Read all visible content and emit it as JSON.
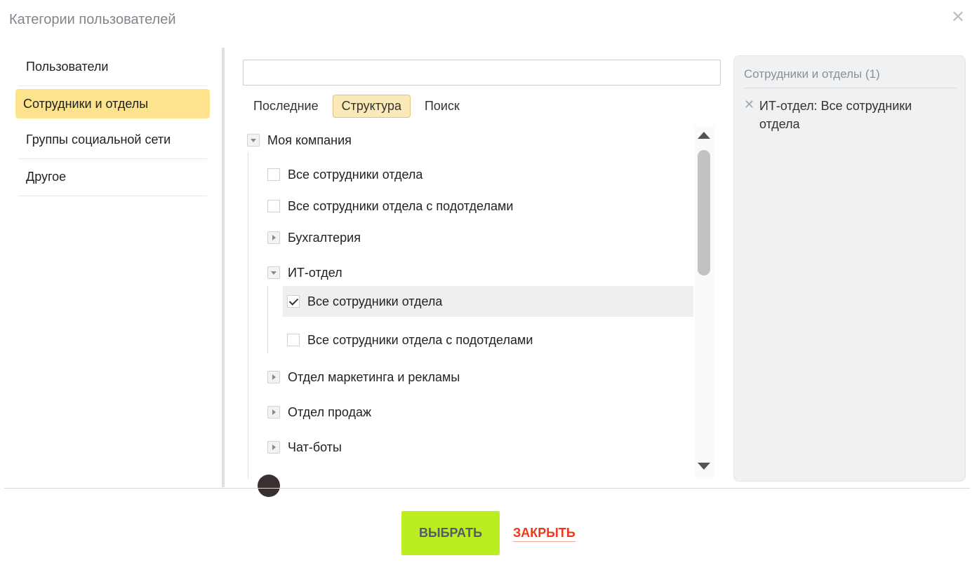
{
  "dialog": {
    "title": "Категории пользователей",
    "close_icon": "close-icon"
  },
  "categories": [
    {
      "label": "Пользователи",
      "active": false
    },
    {
      "label": "Сотрудники и отделы",
      "active": true
    },
    {
      "label": "Группы социальной сети",
      "active": false
    },
    {
      "label": "Другое",
      "active": false
    }
  ],
  "search": {
    "value": "",
    "placeholder": ""
  },
  "tabs": [
    {
      "label": "Последние",
      "active": false
    },
    {
      "label": "Структура",
      "active": true
    },
    {
      "label": "Поиск",
      "active": false
    }
  ],
  "tree": {
    "root": "Моя компания",
    "root_all": "Все сотрудники отдела",
    "root_all_sub": "Все сотрудники отдела с подотделами",
    "dept_accounting": "Бухгалтерия",
    "dept_it": "ИТ-отдел",
    "it_all": "Все сотрудники отдела",
    "it_all_checked": true,
    "it_all_sub": "Все сотрудники отдела с подотделами",
    "dept_marketing": "Отдел маркетинга и рекламы",
    "dept_sales": "Отдел продаж",
    "dept_chatbots": "Чат-боты"
  },
  "selected": {
    "header": "Сотрудники и отделы (1)",
    "items": [
      {
        "label": "ИТ-отдел: Все сотрудники отдела"
      }
    ]
  },
  "footer": {
    "select_label": "ВЫБРАТЬ",
    "close_label": "ЗАКРЫТЬ"
  },
  "colors": {
    "accent_yellow": "#fde38c",
    "select_button": "#bbed21",
    "close_link": "#f1361a"
  }
}
